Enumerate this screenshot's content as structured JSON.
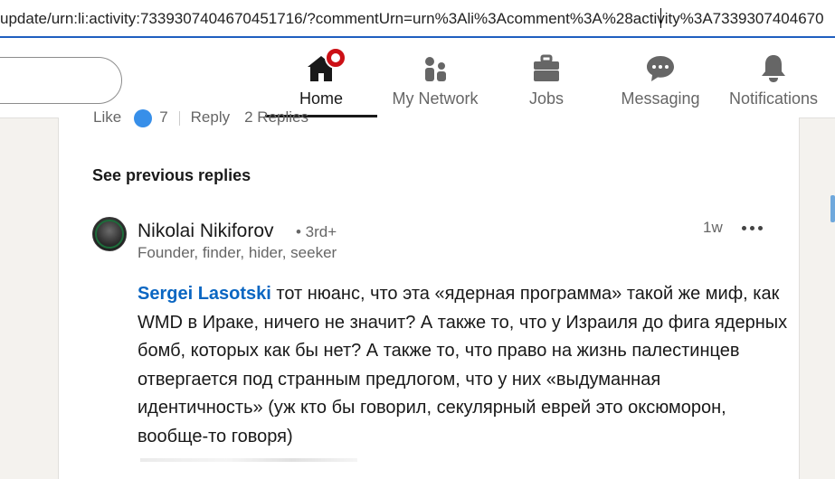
{
  "browser": {
    "url": "update/urn:li:activity:7339307404670451716/?commentUrn=urn%3Ali%3Acomment%3A%28activity%3A7339307404670"
  },
  "nav": {
    "items": [
      {
        "label": "Home",
        "icon": "home-icon",
        "active": true
      },
      {
        "label": "My Network",
        "icon": "people-icon",
        "active": false
      },
      {
        "label": "Jobs",
        "icon": "briefcase-icon",
        "active": false
      },
      {
        "label": "Messaging",
        "icon": "chat-icon",
        "active": false
      },
      {
        "label": "Notifications",
        "icon": "bell-icon",
        "active": false
      }
    ]
  },
  "previous_comment": {
    "like_label": "Like",
    "reaction_count": "7",
    "reply_label": "Reply",
    "replies_label": "2 Replies"
  },
  "thread": {
    "see_previous_label": "See previous replies"
  },
  "comment": {
    "author_name": "Nikolai Nikiforov",
    "degree": "• 3rd+",
    "headline": "Founder, finder, hider, seeker",
    "timestamp": "1w",
    "mention": "Sergei Lasotski",
    "body": " тот нюанс, что эта «ядерная программа» такой же миф, как WMD в Ираке, ничего не значит? А также то, что у Израиля до фига ядерных бомб, которых как бы нет? А также то, что право на жизнь палестинцев отвергается под странным предлогом, что у них «выдуманная идентичность» (уж кто бы говорил, секулярный еврей это оксюморон, вообще-то говоря)"
  },
  "colors": {
    "accent": "#0a66c2",
    "badge": "#cc1016",
    "url_underline": "#1f5fbf"
  }
}
